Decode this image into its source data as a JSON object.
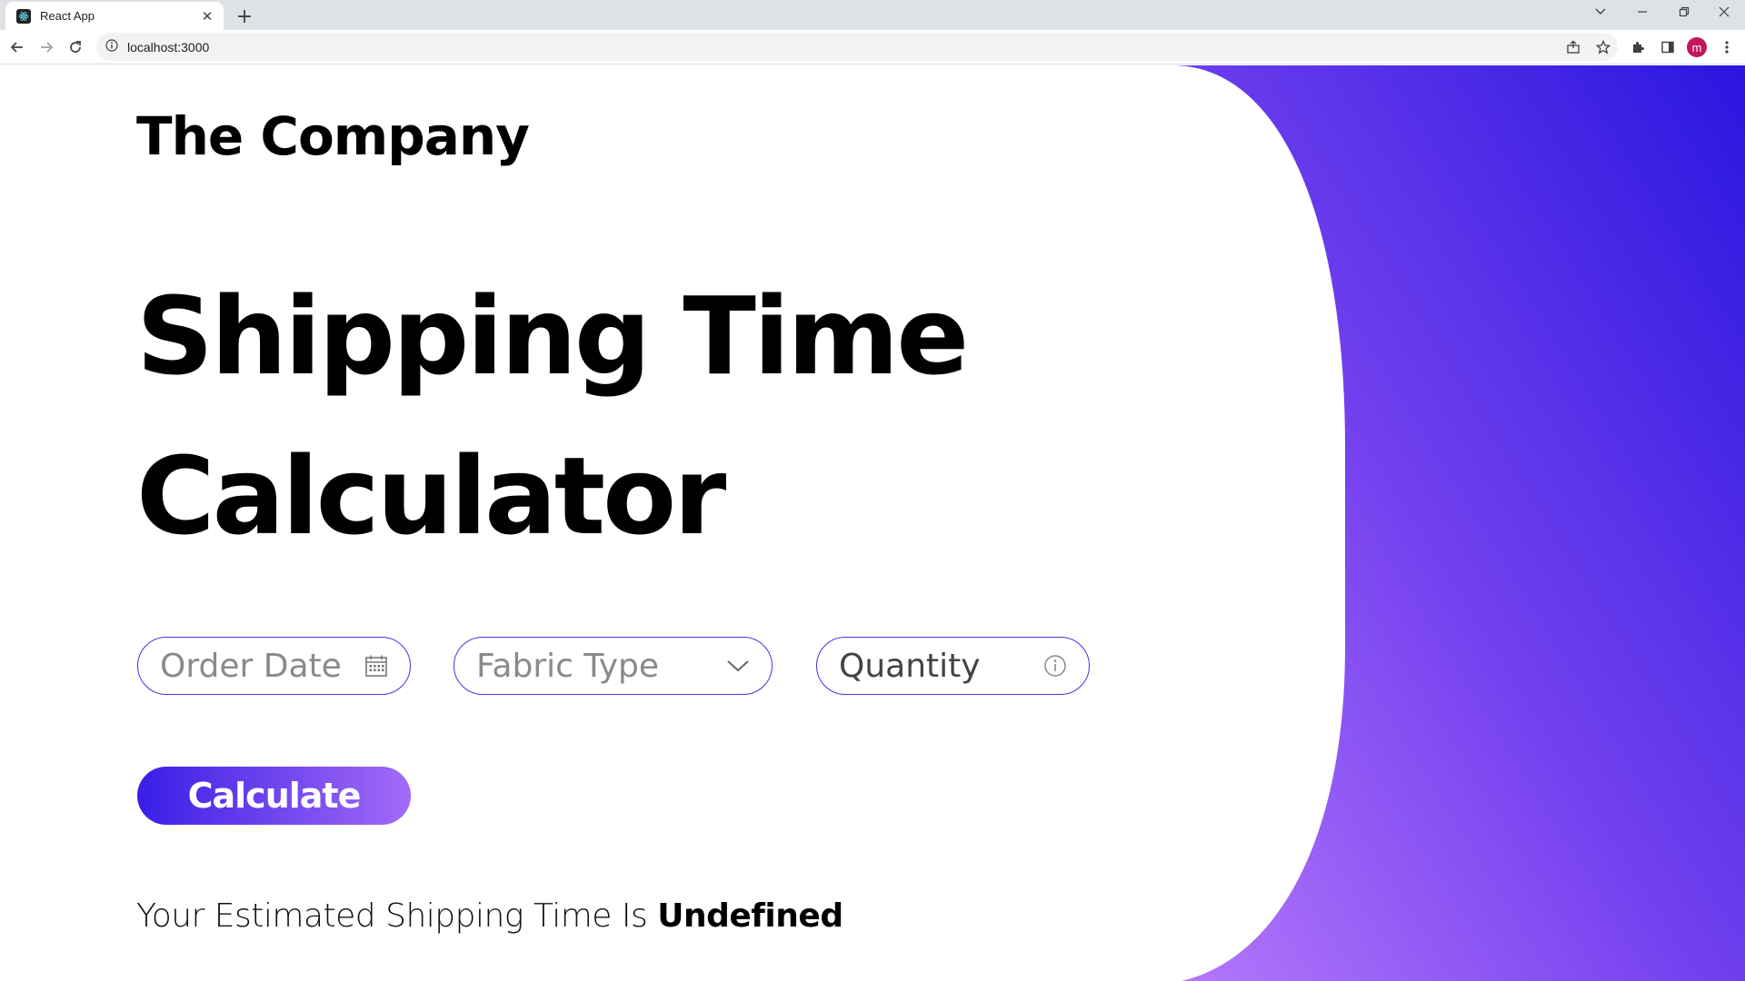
{
  "browser": {
    "tab_title": "React App",
    "tab_close": "✕",
    "new_tab": "+",
    "url": "localhost:3000",
    "profile_initial": "m"
  },
  "page": {
    "brand": "The Company",
    "hero_line1": "Shipping Time",
    "hero_line2": "Calculator",
    "fields": {
      "order_date_placeholder": "Order Date",
      "fabric_type_placeholder": "Fabric Type",
      "quantity_placeholder": "Quantity"
    },
    "calculate_label": "Calculate",
    "result_prefix": "Your Estimated Shipping Time Is",
    "result_value": "Undefined"
  },
  "colors": {
    "accent": "#5a2be6",
    "gradient_dark": "#2d14e0",
    "gradient_light": "#b073fa"
  },
  "icons": [
    "react-favicon",
    "close-icon",
    "plus-icon",
    "back-arrow-icon",
    "forward-arrow-icon",
    "reload-icon",
    "info-icon",
    "share-icon",
    "star-icon",
    "extensions-icon",
    "sidepanel-icon",
    "menu-icon",
    "calendar-icon",
    "chevron-down-icon"
  ]
}
